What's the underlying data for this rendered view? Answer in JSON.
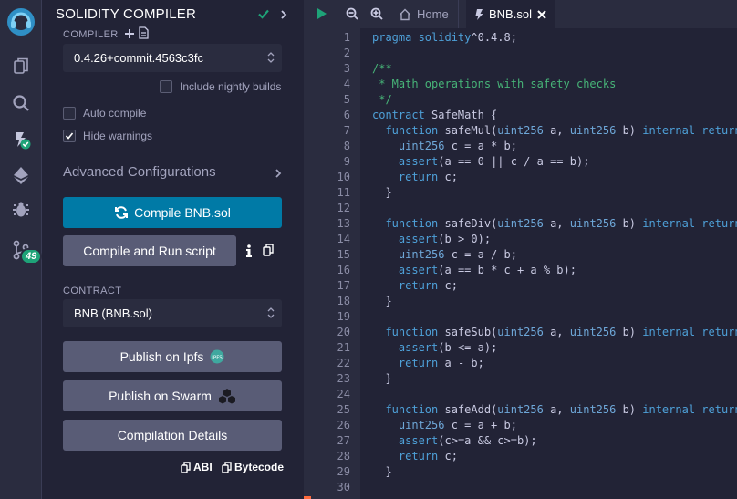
{
  "rail": {
    "badge_count": "49",
    "icons": [
      "remix-logo-icon",
      "file-explorer-icon",
      "search-icon",
      "solidity-compiler-icon",
      "deploy-icon",
      "debugger-icon",
      "git-icon"
    ]
  },
  "panel": {
    "title": "SOLIDITY COMPILER",
    "compiler_label": "COMPILER",
    "compiler_version": "0.4.26+commit.4563c3fc",
    "nightly_label": "Include nightly builds",
    "auto_compile_label": "Auto compile",
    "hide_warnings_label": "Hide warnings",
    "advanced_label": "Advanced Configurations",
    "compile_button": "Compile BNB.sol",
    "compile_run_button": "Compile and Run script",
    "contract_label": "CONTRACT",
    "contract_value": "BNB (BNB.sol)",
    "publish_ipfs": "Publish on Ipfs",
    "publish_swarm": "Publish on Swarm",
    "compilation_details": "Compilation Details",
    "abi_label": "ABI",
    "bytecode_label": "Bytecode",
    "ipfs_badge": "IPFS",
    "colors": {
      "primary": "#007aa6",
      "secondary": "#595c76",
      "success": "#1ea378"
    }
  },
  "editor": {
    "tab_home": "Home",
    "tab_active": "BNB.sol",
    "lines": [
      {
        "n": "1",
        "parts": [
          [
            "kw",
            "pragma solidity"
          ],
          [
            "",
            "^0.4.8;"
          ]
        ]
      },
      {
        "n": "2",
        "parts": []
      },
      {
        "n": "3",
        "parts": [
          [
            "cm",
            "/**"
          ]
        ]
      },
      {
        "n": "4",
        "parts": [
          [
            "cm",
            " * Math operations with safety checks"
          ]
        ]
      },
      {
        "n": "5",
        "parts": [
          [
            "cm",
            " */"
          ]
        ]
      },
      {
        "n": "6",
        "parts": [
          [
            "kw",
            "contract"
          ],
          [
            "",
            " SafeMath {"
          ]
        ]
      },
      {
        "n": "7",
        "parts": [
          [
            "",
            "  "
          ],
          [
            "kw",
            "function"
          ],
          [
            "",
            " safeMul("
          ],
          [
            "ty",
            "uint256"
          ],
          [
            "",
            " a, "
          ],
          [
            "ty",
            "uint256"
          ],
          [
            "",
            " b) "
          ],
          [
            "kw",
            "internal"
          ],
          [
            "",
            " "
          ],
          [
            "kw",
            "returns"
          ]
        ]
      },
      {
        "n": "8",
        "parts": [
          [
            "",
            "    "
          ],
          [
            "ty",
            "uint256"
          ],
          [
            "",
            " c = a * b;"
          ]
        ]
      },
      {
        "n": "9",
        "parts": [
          [
            "",
            "    "
          ],
          [
            "kw",
            "assert"
          ],
          [
            "",
            "(a == 0 || c / a == b);"
          ]
        ]
      },
      {
        "n": "10",
        "parts": [
          [
            "",
            "    "
          ],
          [
            "kw",
            "return"
          ],
          [
            "",
            " c;"
          ]
        ]
      },
      {
        "n": "11",
        "parts": [
          [
            "",
            "  }"
          ]
        ]
      },
      {
        "n": "12",
        "parts": []
      },
      {
        "n": "13",
        "parts": [
          [
            "",
            "  "
          ],
          [
            "kw",
            "function"
          ],
          [
            "",
            " safeDiv("
          ],
          [
            "ty",
            "uint256"
          ],
          [
            "",
            " a, "
          ],
          [
            "ty",
            "uint256"
          ],
          [
            "",
            " b) "
          ],
          [
            "kw",
            "internal"
          ],
          [
            "",
            " "
          ],
          [
            "kw",
            "returns"
          ]
        ]
      },
      {
        "n": "14",
        "parts": [
          [
            "",
            "    "
          ],
          [
            "kw",
            "assert"
          ],
          [
            "",
            "(b > 0);"
          ]
        ]
      },
      {
        "n": "15",
        "parts": [
          [
            "",
            "    "
          ],
          [
            "ty",
            "uint256"
          ],
          [
            "",
            " c = a / b;"
          ]
        ]
      },
      {
        "n": "16",
        "parts": [
          [
            "",
            "    "
          ],
          [
            "kw",
            "assert"
          ],
          [
            "",
            "(a == b * c + a % b);"
          ]
        ]
      },
      {
        "n": "17",
        "parts": [
          [
            "",
            "    "
          ],
          [
            "kw",
            "return"
          ],
          [
            "",
            " c;"
          ]
        ]
      },
      {
        "n": "18",
        "parts": [
          [
            "",
            "  }"
          ]
        ]
      },
      {
        "n": "19",
        "parts": []
      },
      {
        "n": "20",
        "parts": [
          [
            "",
            "  "
          ],
          [
            "kw",
            "function"
          ],
          [
            "",
            " safeSub("
          ],
          [
            "ty",
            "uint256"
          ],
          [
            "",
            " a, "
          ],
          [
            "ty",
            "uint256"
          ],
          [
            "",
            " b) "
          ],
          [
            "kw",
            "internal"
          ],
          [
            "",
            " "
          ],
          [
            "kw",
            "returns"
          ]
        ]
      },
      {
        "n": "21",
        "parts": [
          [
            "",
            "    "
          ],
          [
            "kw",
            "assert"
          ],
          [
            "",
            "(b <= a);"
          ]
        ]
      },
      {
        "n": "22",
        "parts": [
          [
            "",
            "    "
          ],
          [
            "kw",
            "return"
          ],
          [
            "",
            " a - b;"
          ]
        ]
      },
      {
        "n": "23",
        "parts": [
          [
            "",
            "  }"
          ]
        ]
      },
      {
        "n": "24",
        "parts": []
      },
      {
        "n": "25",
        "parts": [
          [
            "",
            "  "
          ],
          [
            "kw",
            "function"
          ],
          [
            "",
            " safeAdd("
          ],
          [
            "ty",
            "uint256"
          ],
          [
            "",
            " a, "
          ],
          [
            "ty",
            "uint256"
          ],
          [
            "",
            " b) "
          ],
          [
            "kw",
            "internal"
          ],
          [
            "",
            " "
          ],
          [
            "kw",
            "returns"
          ]
        ]
      },
      {
        "n": "26",
        "parts": [
          [
            "",
            "    "
          ],
          [
            "ty",
            "uint256"
          ],
          [
            "",
            " c = a + b;"
          ]
        ]
      },
      {
        "n": "27",
        "parts": [
          [
            "",
            "    "
          ],
          [
            "kw",
            "assert"
          ],
          [
            "",
            "(c>=a && c>=b);"
          ]
        ]
      },
      {
        "n": "28",
        "parts": [
          [
            "",
            "    "
          ],
          [
            "kw",
            "return"
          ],
          [
            "",
            " c;"
          ]
        ]
      },
      {
        "n": "29",
        "parts": [
          [
            "",
            "  }"
          ]
        ]
      },
      {
        "n": "30",
        "parts": []
      }
    ]
  }
}
